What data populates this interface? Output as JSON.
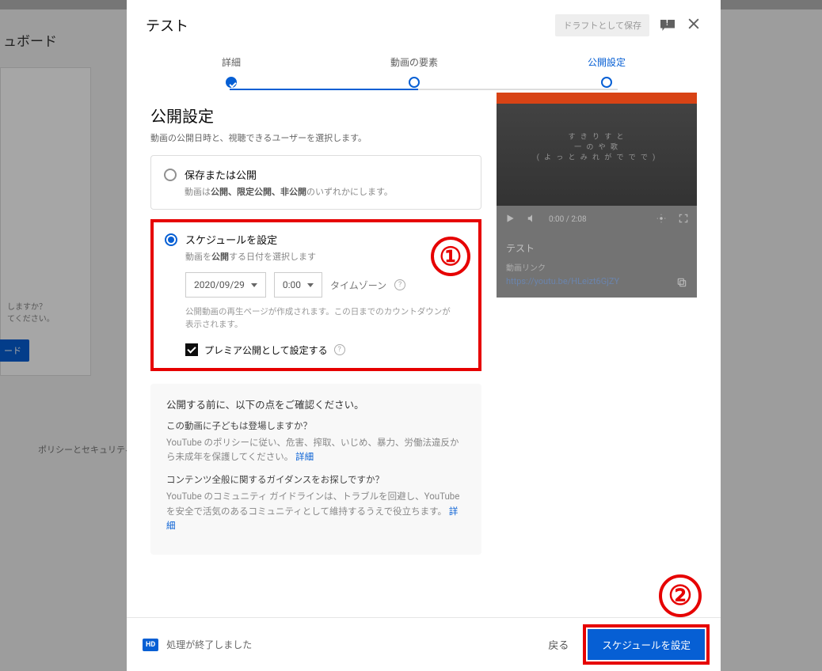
{
  "background": {
    "page_title": "ュボード",
    "prompt_line1": "しますか？",
    "prompt_line2": "てください。",
    "button_label": "ード",
    "footer": "ポリシーとセキュリティ"
  },
  "dialog": {
    "title": "テスト",
    "draft_button": "ドラフトとして保存"
  },
  "stepper": {
    "step1": "詳細",
    "step2": "動画の要素",
    "step3": "公開設定"
  },
  "publish": {
    "title": "公開設定",
    "subtitle": "動画の公開日時と、視聴できるユーザーを選択します。"
  },
  "option_save": {
    "title": "保存または公開",
    "sub_prefix": "動画は",
    "sub_bold": "公開、限定公開、非公開",
    "sub_suffix": "のいずれかにします。"
  },
  "option_schedule": {
    "title": "スケジュールを設定",
    "sub_prefix": "動画を",
    "sub_bold": "公開",
    "sub_suffix": "する日付を選択します",
    "date_value": "2020/09/29",
    "time_value": "0:00",
    "timezone_label": "タイムゾーン",
    "note": "公開動画の再生ページが作成されます。この日までのカウントダウンが表示されます。",
    "premiere_label": "プレミア公開として設定する"
  },
  "info": {
    "heading": "公開する前に、以下の点をご確認ください。",
    "q1": "この動画に子どもは登場しますか？",
    "p1": "YouTube のポリシーに従い、危害、搾取、いじめ、暴力、労働法違反から未成年を保護してください。",
    "q2": "コンテンツ全般に関するガイダンスをお探しですか？",
    "p2": "YouTube のコミュニティ ガイドラインは、トラブルを回避し、YouTube を安全で活気のあるコミュニティとして維持するうえで役立ちます。",
    "link": "詳細"
  },
  "video": {
    "thumb_line1": "す き り す と",
    "thumb_line2": "一 の や 歌",
    "thumb_line3": "( よ っ と み れ が で で で )",
    "time": "0:00 / 2:08",
    "title": "テスト",
    "link_label": "動画リンク",
    "link_value": "https://youtu.be/HLeizt6GjZY"
  },
  "footer": {
    "hd": "HD",
    "processing": "処理が終了しました",
    "back": "戻る",
    "submit": "スケジュールを設定"
  },
  "annotations": {
    "one": "①",
    "two": "②"
  }
}
